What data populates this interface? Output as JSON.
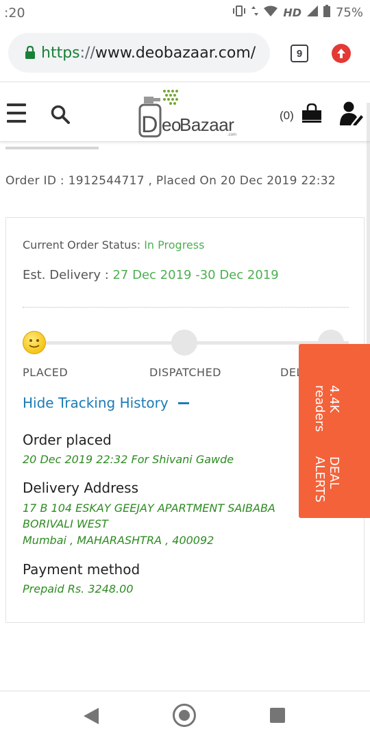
{
  "status_bar": {
    "time": ":20",
    "network_label": "HD",
    "battery": "75%"
  },
  "browser": {
    "url_scheme": "https",
    "url_sep": "://",
    "url_host": "www.deobazaar.com/",
    "tab_count": "9"
  },
  "header": {
    "logo_first": "D",
    "logo_eo": "eo",
    "logo_bazaar": "Bazaar",
    "logo_com": ".com",
    "cart_count": "(0)"
  },
  "order": {
    "summary": "Order ID : 1912544717 , Placed On 20 Dec 2019 22:32",
    "status_label": "Current Order Status: ",
    "status_value": "In Progress",
    "delivery_label": "Est. Delivery : ",
    "delivery_value": "27 Dec 2019 -30 Dec 2019",
    "steps": [
      "PLACED",
      "DISPATCHED",
      "DEL"
    ],
    "hide_history": "Hide Tracking History",
    "history": {
      "placed_title": "Order placed",
      "placed_detail": "20 Dec 2019 22:32 For Shivani Gawde",
      "address_title": "Delivery Address",
      "address_line1": "17 B 104 ESKAY GEEJAY APARTMENT SAIBABA",
      "address_line2": "BORIVALI WEST",
      "address_line3": "Mumbai , MAHARASHTRA , 400092",
      "payment_title": "Payment method",
      "payment_detail": "Prepaid Rs. 3248.00"
    }
  },
  "deal_alerts": {
    "title": "DEAL ALERTS",
    "readers": "4.4K readers"
  },
  "colors": {
    "green_status": "#4caf50",
    "link_blue": "#1a7bb5",
    "history_green": "#2e8b22",
    "deal_orange": "#f4623a"
  }
}
